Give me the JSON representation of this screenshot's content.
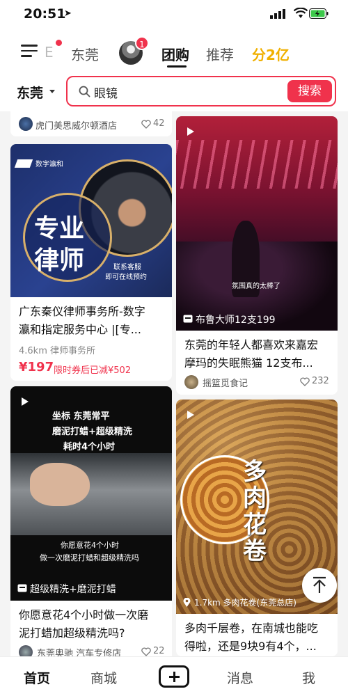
{
  "status": {
    "time": "20:51",
    "location_arrow": "➤"
  },
  "topnav": {
    "partial_tab": "E",
    "tabs": [
      "东莞",
      "团购",
      "推荐",
      "分2亿"
    ],
    "avatar_badge": "1"
  },
  "search": {
    "city": "东莞",
    "query": "眼镜",
    "button": "搜索"
  },
  "cards": {
    "top_partial": {
      "author": "虎门美思威尔顿酒店",
      "likes": "42"
    },
    "lawyer": {
      "logo": "数字瀛和",
      "big_text_1": "专业",
      "big_text_2": "律师",
      "corner_1": "联系客服",
      "corner_2": "即可在线预约",
      "title_1": "广东秦仪律师事务所-数字",
      "title_2": "瀛和指定服务中心 |[专...",
      "meta": "4.6km  律师事务所",
      "price": "¥197",
      "discount": "限时券后已减¥502"
    },
    "bar": {
      "caption": "氛围真的太棒了",
      "tag": "布鲁大师12支199",
      "title_1": "东莞的年轻人都喜欢来嘉宏",
      "title_2": "摩玛的失眠熊猫 12支布...",
      "author": "摇篮觅食记",
      "likes": "232"
    },
    "car": {
      "caption_1": "坐标    东莞常平",
      "caption_2": "磨泥打蜡+超级精洗",
      "caption_3": "耗时4个小时",
      "caption_4": "你愿意花4个小时",
      "caption_5": "做一次磨泥打蜡和超级精洗吗",
      "tag": "超级精洗+磨泥打蜡",
      "title_1": "你愿意花4个小时做一次磨",
      "title_2": "泥打蜡加超级精洗吗?",
      "author": "东莞奥驰  汽车专修店",
      "likes": "22"
    },
    "food": {
      "big_1": "多",
      "big_2": "肉",
      "big_3": "花",
      "big_4": "卷",
      "location": "1.7km   多肉花卷(东莞总店)",
      "title_1": "多肉千层卷，在南城也能吃",
      "title_2": "得啦，还是9块9有4个，..."
    }
  },
  "bottomnav": {
    "items": [
      "首页",
      "商城",
      "消息",
      "我"
    ]
  },
  "colors": {
    "accent": "#f0324c",
    "gold": "#f0b000"
  }
}
